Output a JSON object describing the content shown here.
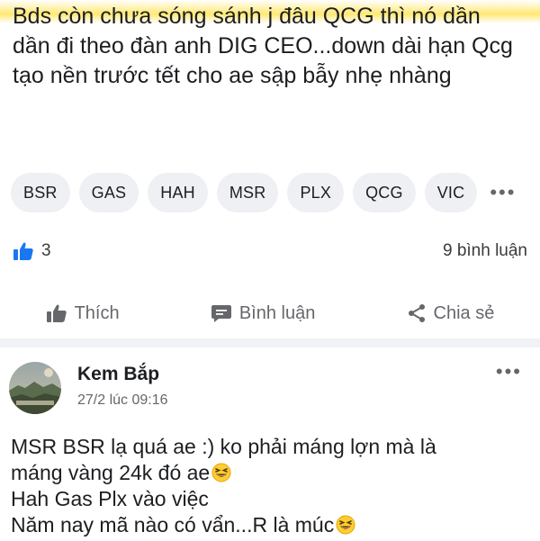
{
  "post1": {
    "text": "Bds còn chưa sóng sánh j đâu QCG thì nó dần dần đi theo đàn anh DIG CEO...down dài hạn Qcg tạo nền trước tết cho ae sập bẫy nhẹ nhàng",
    "tags": [
      "BSR",
      "GAS",
      "HAH",
      "MSR",
      "PLX",
      "QCG",
      "VIC"
    ],
    "more_tags": "•••",
    "like_count": "3",
    "comment_count": "9 bình luận",
    "actions": {
      "like": "Thích",
      "comment": "Bình luận",
      "share": "Chia sẻ"
    },
    "colors": {
      "like_blue": "#1877f2",
      "highlight": "#ffd600"
    }
  },
  "post2": {
    "author": "Kem Bắp",
    "time": "27/2 lúc 09:16",
    "more": "•••",
    "lines": [
      "MSR BSR  lạ quá ae :) ko phải máng lợn mà là",
      "máng vàng 24k đó ae",
      "Hah Gas Plx vào việc",
      "Năm nay mã nào có vẩn...R là múc"
    ],
    "emoji": "grinning-squinting-face-emoji"
  }
}
